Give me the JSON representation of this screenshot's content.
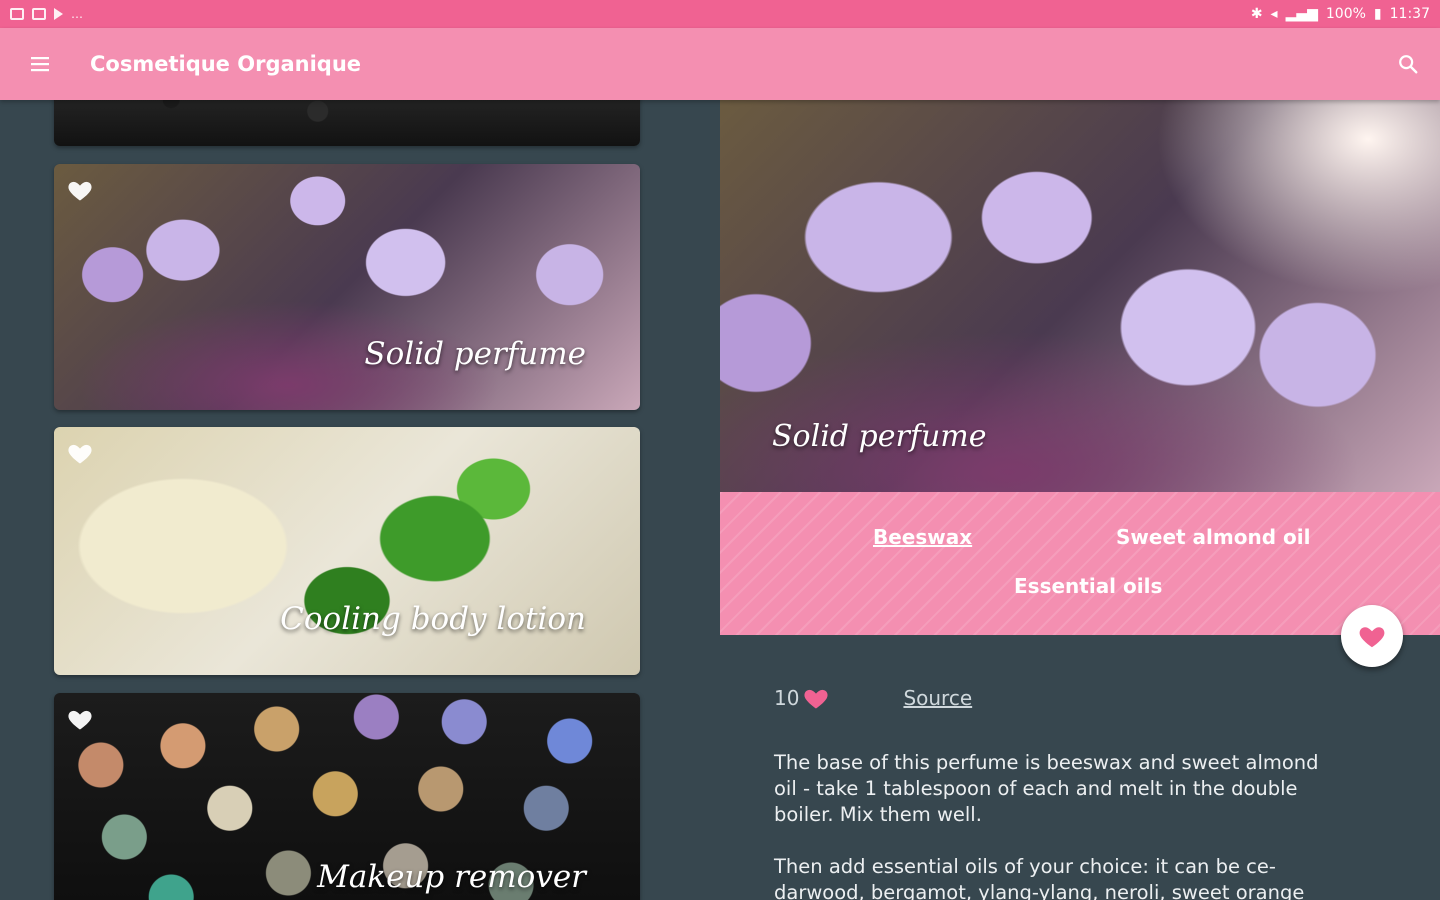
{
  "status_bar": {
    "battery": "100%",
    "time": "11:37"
  },
  "app_bar": {
    "title": "Cosmetique Organique"
  },
  "list": {
    "cards": [
      {
        "title": "Solid perfume"
      },
      {
        "title": "Cooling body lotion"
      },
      {
        "title": "Makeup remover"
      }
    ]
  },
  "detail": {
    "title": "Solid perfume",
    "ingredients": [
      "Beeswax",
      "Sweet almond oil",
      "Essential oils"
    ],
    "likes": "10",
    "source_label": "Source",
    "paragraphs": [
      "The base of this perfume is beeswax and sweet almond oil - take 1 tablespoon of each and melt in the double boiler. Mix them well.",
      "Then add essential oils of your choice: it can be ce-darwood, bergamot, ylang-ylang, neroli, sweet orange"
    ]
  },
  "colors": {
    "status_bar": "#f06292",
    "app_bar": "#f48fb1",
    "background": "#37474f",
    "accent_heart": "#f06292"
  },
  "icons": [
    "menu-icon",
    "search-icon",
    "heart-outline-icon",
    "heart-icon"
  ]
}
